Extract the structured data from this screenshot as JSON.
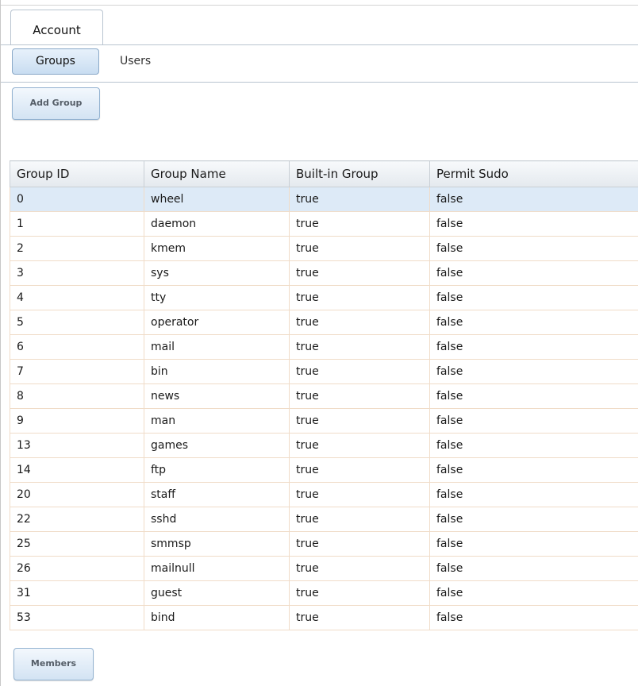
{
  "tabs": {
    "main": [
      {
        "label": "Account",
        "active": true
      }
    ],
    "sub": [
      {
        "label": "Groups",
        "active": true
      },
      {
        "label": "Users",
        "active": false
      }
    ]
  },
  "toolbar": {
    "add_group_label": "Add Group"
  },
  "table": {
    "columns": [
      "Group ID",
      "Group Name",
      "Built-in Group",
      "Permit Sudo"
    ],
    "rows": [
      [
        "0",
        "wheel",
        "true",
        "false"
      ],
      [
        "1",
        "daemon",
        "true",
        "false"
      ],
      [
        "2",
        "kmem",
        "true",
        "false"
      ],
      [
        "3",
        "sys",
        "true",
        "false"
      ],
      [
        "4",
        "tty",
        "true",
        "false"
      ],
      [
        "5",
        "operator",
        "true",
        "false"
      ],
      [
        "6",
        "mail",
        "true",
        "false"
      ],
      [
        "7",
        "bin",
        "true",
        "false"
      ],
      [
        "8",
        "news",
        "true",
        "false"
      ],
      [
        "9",
        "man",
        "true",
        "false"
      ],
      [
        "13",
        "games",
        "true",
        "false"
      ],
      [
        "14",
        "ftp",
        "true",
        "false"
      ],
      [
        "20",
        "staff",
        "true",
        "false"
      ],
      [
        "22",
        "sshd",
        "true",
        "false"
      ],
      [
        "25",
        "smmsp",
        "true",
        "false"
      ],
      [
        "26",
        "mailnull",
        "true",
        "false"
      ],
      [
        "31",
        "guest",
        "true",
        "false"
      ],
      [
        "53",
        "bind",
        "true",
        "false"
      ]
    ],
    "selected_row": 0
  },
  "footer": {
    "members_label": "Members"
  },
  "colors": {
    "selected_row": "#ddeaf7",
    "button_border": "#94b3d1",
    "grid_line": "#f0dcc8"
  }
}
